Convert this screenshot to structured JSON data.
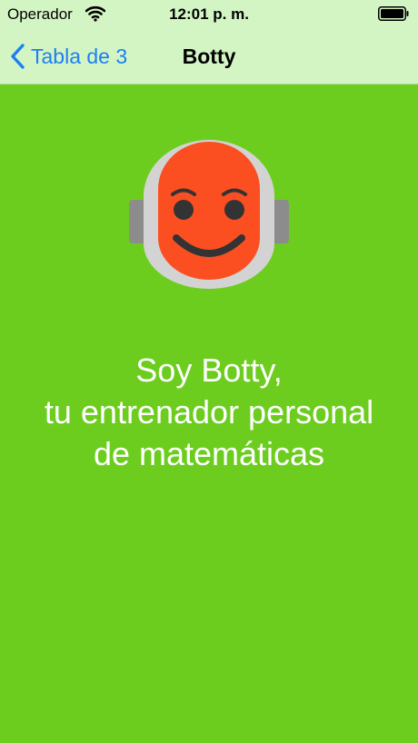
{
  "status_bar": {
    "carrier": "Operador",
    "time": "12:01 p. m.",
    "wifi_icon": "wifi-icon",
    "battery_icon": "battery-icon"
  },
  "nav_bar": {
    "back_label": "Tabla de 3",
    "back_icon": "chevron-left-icon",
    "title": "Botty"
  },
  "main": {
    "avatar_icon": "robot-face-icon",
    "intro_lines": [
      "Soy Botty,",
      "tu entrenador personal",
      "de matemáticas"
    ]
  },
  "colors": {
    "background": "#6ccd1f",
    "bars": "#d3f5c4",
    "accent": "#1e7ff5",
    "robot_face": "#fb4f22",
    "robot_helmet": "#d3d3d3",
    "robot_ears": "#8c8c8c",
    "robot_features": "#333333"
  }
}
